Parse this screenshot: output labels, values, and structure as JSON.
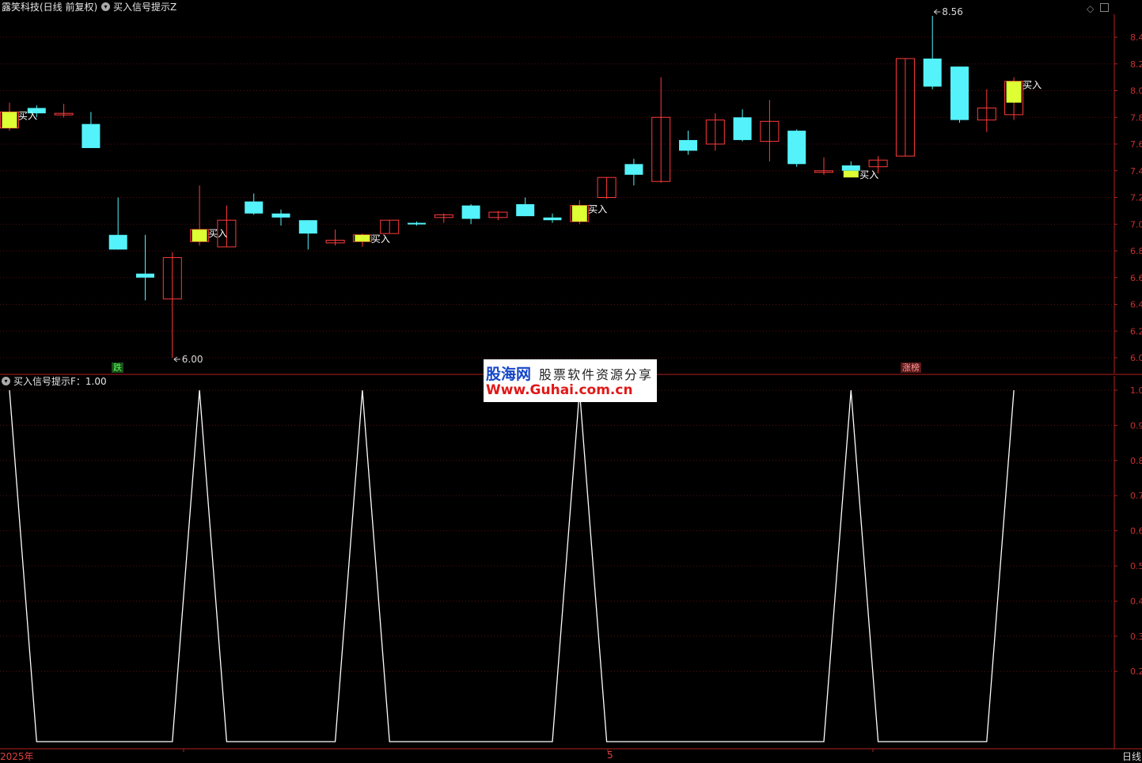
{
  "header": {
    "stock_label": "露笑科技(日线 前复权)",
    "indicator_label": "买入信号提示Z"
  },
  "subchart": {
    "title": "买入信号提示F：1.00"
  },
  "tags": {
    "fall": "跌",
    "rise": "涨榜"
  },
  "watermark": {
    "logo": "股海网",
    "slogan": "股票软件资源分享",
    "url": "Www.Guhai.com.cn"
  },
  "bottom": {
    "year_label": "2025年",
    "month_label": "5",
    "period_label": "日线"
  },
  "colors": {
    "up": "#ff3b3b",
    "down": "#54f2fa",
    "buy_marker": "#ddff33",
    "grid": "#5a0e0e",
    "axis": "#b52020",
    "signal_line": "#ffffff"
  },
  "chart_data": [
    {
      "type": "candlestick",
      "title": "露笑科技(日线 前复权)",
      "ylim": [
        6.0,
        8.4
      ],
      "y_ticks": [
        6.0,
        6.2,
        6.4,
        6.6,
        6.8,
        7.0,
        7.2,
        7.4,
        7.6,
        7.8,
        8.0,
        8.2,
        8.4
      ],
      "candles": [
        {
          "o": 7.72,
          "h": 7.91,
          "l": 7.7,
          "c": 7.84
        },
        {
          "o": 7.87,
          "h": 7.89,
          "l": 7.8,
          "c": 7.83
        },
        {
          "o": 7.82,
          "h": 7.9,
          "l": 7.8,
          "c": 7.83
        },
        {
          "o": 7.75,
          "h": 7.84,
          "l": 7.57,
          "c": 7.57
        },
        {
          "o": 6.92,
          "h": 7.2,
          "l": 6.81,
          "c": 6.81
        },
        {
          "o": 6.63,
          "h": 6.92,
          "l": 6.43,
          "c": 6.6
        },
        {
          "o": 6.44,
          "h": 6.79,
          "l": 6.0,
          "c": 6.75
        },
        {
          "o": 6.87,
          "h": 7.29,
          "l": 6.84,
          "c": 6.96
        },
        {
          "o": 6.83,
          "h": 7.14,
          "l": 6.83,
          "c": 7.03
        },
        {
          "o": 7.17,
          "h": 7.23,
          "l": 7.07,
          "c": 7.08
        },
        {
          "o": 7.08,
          "h": 7.11,
          "l": 6.99,
          "c": 7.05
        },
        {
          "o": 7.03,
          "h": 7.03,
          "l": 6.81,
          "c": 6.93
        },
        {
          "o": 6.86,
          "h": 6.96,
          "l": 6.84,
          "c": 6.88
        },
        {
          "o": 6.87,
          "h": 6.93,
          "l": 6.83,
          "c": 6.92
        },
        {
          "o": 6.93,
          "h": 7.03,
          "l": 6.93,
          "c": 7.03
        },
        {
          "o": 7.01,
          "h": 7.02,
          "l": 6.99,
          "c": 7.0
        },
        {
          "o": 7.05,
          "h": 7.08,
          "l": 7.01,
          "c": 7.07
        },
        {
          "o": 7.14,
          "h": 7.15,
          "l": 7.0,
          "c": 7.04
        },
        {
          "o": 7.05,
          "h": 7.1,
          "l": 7.03,
          "c": 7.09
        },
        {
          "o": 7.15,
          "h": 7.2,
          "l": 7.06,
          "c": 7.06
        },
        {
          "o": 7.05,
          "h": 7.08,
          "l": 7.01,
          "c": 7.03
        },
        {
          "o": 7.02,
          "h": 7.18,
          "l": 7.0,
          "c": 7.14
        },
        {
          "o": 7.2,
          "h": 7.35,
          "l": 7.19,
          "c": 7.35
        },
        {
          "o": 7.45,
          "h": 7.49,
          "l": 7.29,
          "c": 7.37
        },
        {
          "o": 7.32,
          "h": 8.1,
          "l": 7.31,
          "c": 7.8
        },
        {
          "o": 7.63,
          "h": 7.7,
          "l": 7.52,
          "c": 7.55
        },
        {
          "o": 7.6,
          "h": 7.83,
          "l": 7.55,
          "c": 7.78
        },
        {
          "o": 7.8,
          "h": 7.86,
          "l": 7.62,
          "c": 7.63
        },
        {
          "o": 7.62,
          "h": 7.93,
          "l": 7.47,
          "c": 7.77
        },
        {
          "o": 7.7,
          "h": 7.71,
          "l": 7.43,
          "c": 7.45
        },
        {
          "o": 7.39,
          "h": 7.5,
          "l": 7.37,
          "c": 7.4
        },
        {
          "o": 7.44,
          "h": 7.47,
          "l": 7.38,
          "c": 7.4
        },
        {
          "o": 7.43,
          "h": 7.51,
          "l": 7.38,
          "c": 7.48
        },
        {
          "o": 7.51,
          "h": 8.24,
          "l": 7.51,
          "c": 8.24
        },
        {
          "o": 8.24,
          "h": 8.56,
          "l": 8.01,
          "c": 8.03
        },
        {
          "o": 8.18,
          "h": 8.18,
          "l": 7.76,
          "c": 7.78
        },
        {
          "o": 7.78,
          "h": 8.01,
          "l": 7.69,
          "c": 7.87
        },
        {
          "o": 7.82,
          "h": 8.1,
          "l": 7.78,
          "c": 8.07
        }
      ],
      "buy_markers": [
        {
          "index": 0,
          "label": "买入"
        },
        {
          "index": 7,
          "label": "买入"
        },
        {
          "index": 13,
          "label": "买入"
        },
        {
          "index": 21,
          "label": "买入"
        },
        {
          "index": 31,
          "label": "买入"
        },
        {
          "index": 37,
          "label": "买入"
        }
      ],
      "annotations": [
        {
          "index": 6,
          "value": 6.0,
          "text": "6.00"
        },
        {
          "index": 34,
          "value": 8.56,
          "text": "8.56"
        }
      ]
    },
    {
      "type": "line",
      "title": "买入信号提示F",
      "ylim": [
        0,
        1
      ],
      "y_ticks": [
        0.2,
        0.3,
        0.4,
        0.5,
        0.6,
        0.7,
        0.8,
        0.9,
        1.0
      ],
      "values": [
        1,
        0,
        0,
        0,
        0,
        0,
        0,
        1,
        0,
        0,
        0,
        0,
        0,
        1,
        0,
        0,
        0,
        0,
        0,
        0,
        0,
        1,
        0,
        0,
        0,
        0,
        0,
        0,
        0,
        0,
        0,
        1,
        0,
        0,
        0,
        0,
        0,
        1
      ]
    }
  ]
}
